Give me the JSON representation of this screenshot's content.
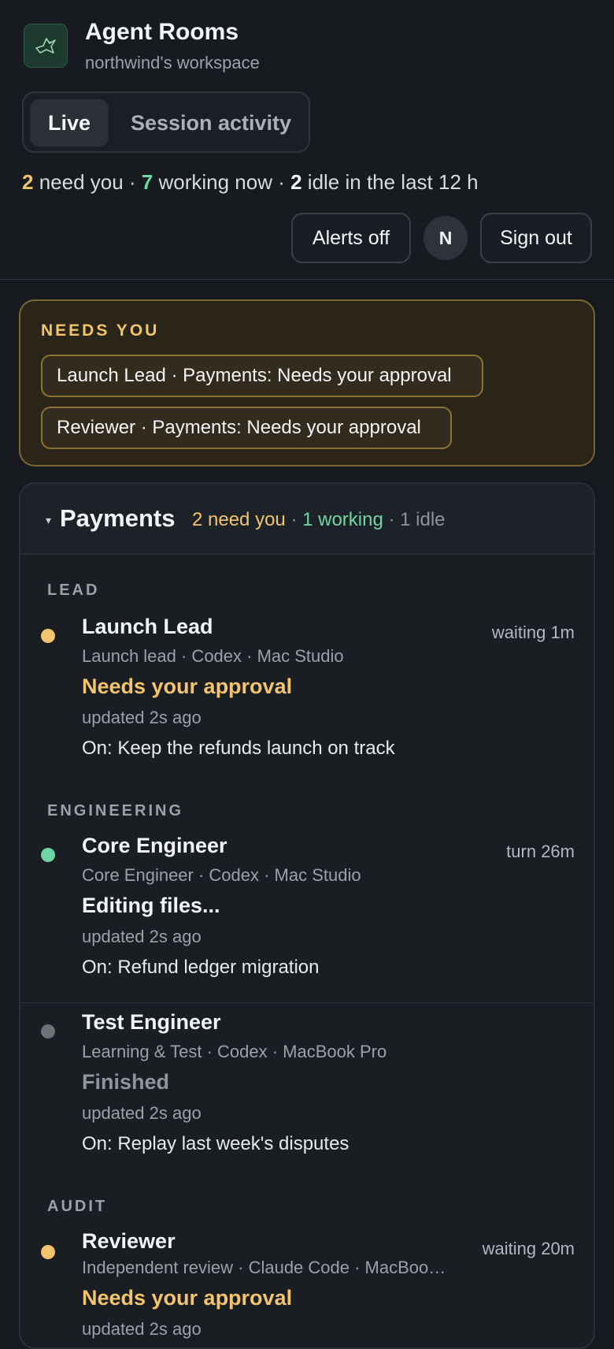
{
  "app": {
    "title": "Agent Rooms",
    "workspace": "northwind's workspace",
    "logo_icon": "bird-icon"
  },
  "tabs": [
    {
      "label": "Live",
      "active": true
    },
    {
      "label": "Session activity",
      "active": false
    }
  ],
  "summary": {
    "need_count": "2",
    "need_text": " need you · ",
    "working_count": "7",
    "working_text": " working now · ",
    "idle_count": "2",
    "idle_text": " idle in the last 12 h"
  },
  "actions": {
    "alerts": "Alerts off",
    "avatar": "N",
    "sign_out": "Sign out"
  },
  "needs_you": {
    "title": "NEEDS YOU",
    "items": [
      "Launch Lead · Payments: Needs your approval",
      "Reviewer · Payments: Needs your approval"
    ]
  },
  "room": {
    "caret": "▾",
    "name": "Payments",
    "need": "2 need you",
    "sep1": " · ",
    "working": "1 working",
    "sep2": " · ",
    "idle": "1 idle"
  },
  "sections": [
    {
      "title": "LEAD",
      "agents": [
        {
          "name": "Launch Lead",
          "meta": "Launch lead · Codex · Mac Studio",
          "status": "Needs your approval",
          "updated": "updated 2s ago",
          "on": "On: Keep the refunds launch on track",
          "time": "waiting 1m"
        }
      ]
    },
    {
      "title": "ENGINEERING",
      "agents": [
        {
          "name": "Core Engineer",
          "meta": "Core Engineer · Codex · Mac Studio",
          "status": "Editing files...",
          "updated": "updated 2s ago",
          "on": "On: Refund ledger migration",
          "time": "turn 26m"
        },
        {
          "name": "Test Engineer",
          "meta": "Learning & Test · Codex · MacBook Pro",
          "status": "Finished",
          "updated": "updated 2s ago",
          "on": "On: Replay last week's disputes",
          "time": ""
        }
      ]
    },
    {
      "title": "AUDIT",
      "agents": [
        {
          "name": "Reviewer",
          "meta": "Independent review · Claude Code · MacBook Pro",
          "status": "Needs your approval",
          "updated": "updated 2s ago",
          "on": "",
          "time": "waiting 20m"
        }
      ]
    }
  ],
  "colors": {
    "amber": "#f2c46d",
    "green": "#6fd6a3",
    "gray": "#6b7079",
    "background": "#16191e"
  }
}
